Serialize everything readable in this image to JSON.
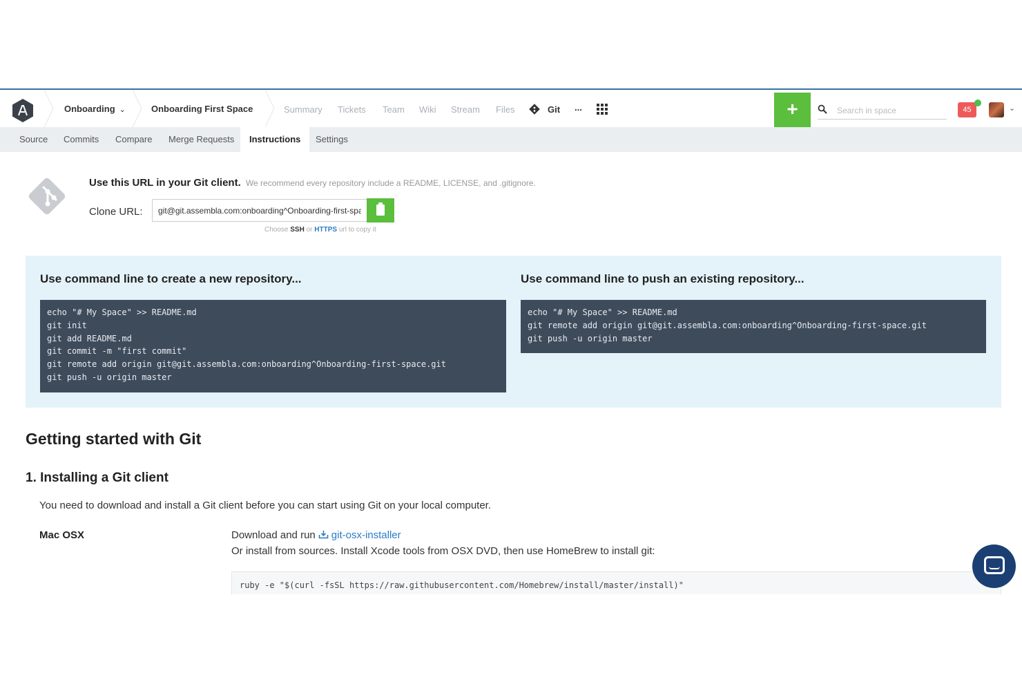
{
  "topnav": {
    "org": "Onboarding",
    "space": "Onboarding First Space",
    "links": [
      "Summary",
      "Tickets",
      "Team",
      "Wiki",
      "Stream",
      "Files"
    ],
    "active_link": "Git",
    "more": "...",
    "plus": "+",
    "search_placeholder": "Search in space",
    "notifications": "45"
  },
  "subnav": {
    "tabs": [
      "Source",
      "Commits",
      "Compare",
      "Merge Requests",
      "Instructions",
      "Settings"
    ],
    "active": "Instructions"
  },
  "clone": {
    "heading": "Use this URL in your Git client.",
    "recommend": "We recommend every repository include a README, LICENSE, and .gitignore.",
    "label": "Clone URL:",
    "url": "git@git.assembla.com:onboarding^Onboarding-first-space.git",
    "choose_prefix": "Choose",
    "ssh": "SSH",
    "or": "or",
    "https": "HTTPS",
    "choose_suffix": "url to copy it"
  },
  "commands": {
    "new_title": "Use command line to create a new repository...",
    "new_code": "echo \"# My Space\" >> README.md\ngit init\ngit add README.md\ngit commit -m \"first commit\"\ngit remote add origin git@git.assembla.com:onboarding^Onboarding-first-space.git\ngit push -u origin master",
    "push_title": "Use command line to push an existing repository...",
    "push_code": "echo \"# My Space\" >> README.md\ngit remote add origin git@git.assembla.com:onboarding^Onboarding-first-space.git\ngit push -u origin master"
  },
  "guide": {
    "title": "Getting started with Git",
    "section1": "1. Installing a Git client",
    "intro": "You need to download and install a Git client before you can start using Git on your local computer.",
    "mac_label": "Mac OSX",
    "download_prefix": "Download and run",
    "installer_link": "git-osx-installer",
    "or_install": "Or install from sources. Install Xcode tools from OSX DVD, then use HomeBrew to install git:",
    "ruby_cmd": "ruby -e \"$(curl -fsSL https://raw.githubusercontent.com/Homebrew/install/master/install)\""
  },
  "colors": {
    "accent_green": "#5bbe3c",
    "code_bg": "#3e4b5b",
    "panel_bg": "#e4f3fa",
    "link_blue": "#2a7dc6",
    "badge_red": "#ee5a5a"
  }
}
